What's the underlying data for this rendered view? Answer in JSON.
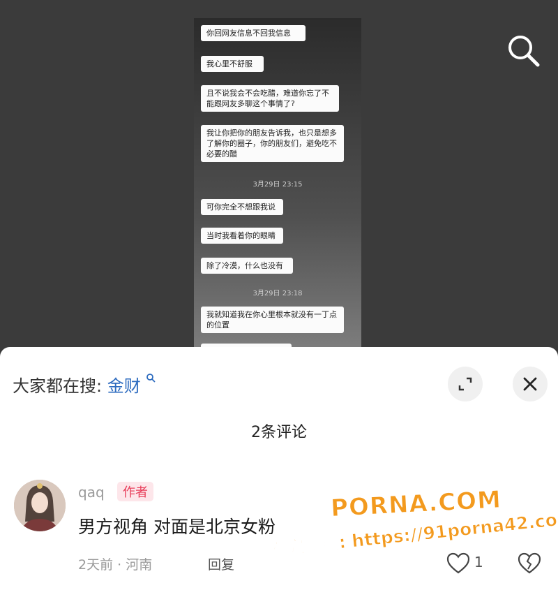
{
  "video": {
    "chat": {
      "m1": "你回网友信息不回我信息",
      "m2": "我心里不舒服",
      "m3": "且不说我会不会吃醋，难道你忘了不能跟网友多聊这个事情了?",
      "m4": "我让你把你的朋友告诉我，也只是想多了解你的圈子，你的朋友们，避免吃不必要的醋",
      "t1": "3月29日 23:15",
      "m5": "可你完全不想跟我说",
      "m6": "当时我看着你的眼睛",
      "m7": "除了冷漠，什么也没有",
      "t2": "3月29日 23:18",
      "m8": "我就知道我在你心里根本就没有一丁点的位置"
    }
  },
  "sheet": {
    "hot_prefix": "大家都在搜:",
    "hot_term": "金财",
    "title": "2条评论"
  },
  "comment": {
    "username": "qaq",
    "badge": "作者",
    "text": "男方视角 对面是北京女粉",
    "meta": "2天前 · 河南",
    "reply": "回复",
    "likes": "1"
  },
  "watermark": {
    "brand": "PORNA.COM",
    "line2": "看完整版: https://91porna42.com"
  },
  "colors": {
    "hot_term": "#2d6bbf",
    "badge_text": "#e83e5a",
    "badge_bg": "#fde6ea",
    "watermark": "#f39a1e"
  }
}
